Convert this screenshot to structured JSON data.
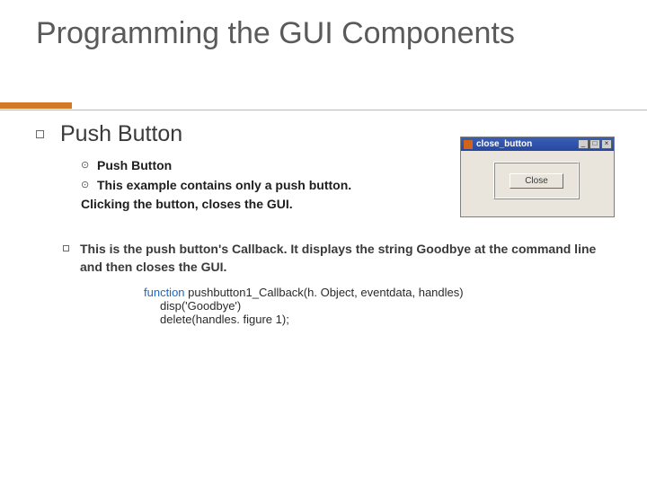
{
  "title": "Programming the GUI Components",
  "section": "Push Button",
  "sub": {
    "a": "Push Button",
    "b": "This example contains only a push button.",
    "c": "Clicking the button, closes the GUI."
  },
  "callback": "This is the push button's Callback. It displays the string Goodbye at the command line and then closes the GUI.",
  "code": {
    "kw": "function",
    "sig": " pushbutton1_Callback(h. Object, eventdata, handles)",
    "l2": "disp('Goodbye')",
    "l3": "delete(handles. figure 1);"
  },
  "figwin": {
    "title": "close_button",
    "minimize_glyph": "_",
    "maximize_glyph": "□",
    "close_glyph": "×",
    "button_label": "Close"
  }
}
